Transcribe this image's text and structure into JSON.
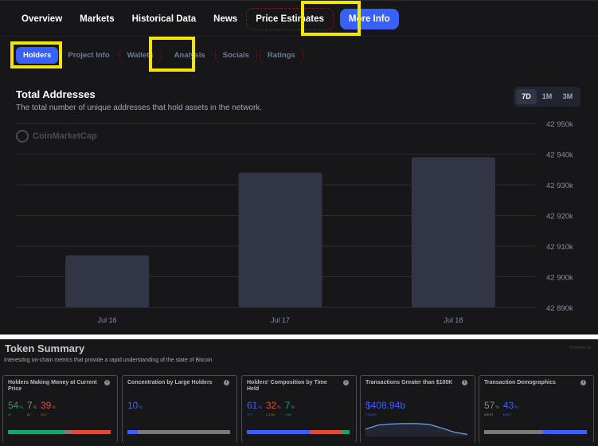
{
  "nav": {
    "items": [
      {
        "label": "Overview"
      },
      {
        "label": "Markets"
      },
      {
        "label": "Historical Data"
      },
      {
        "label": "News"
      },
      {
        "label": "Price Estimates"
      },
      {
        "label": "More Info"
      }
    ],
    "active": "More Info"
  },
  "subnav": {
    "items": [
      {
        "label": "Holders"
      },
      {
        "label": "Project Info"
      },
      {
        "label": "Wallets"
      },
      {
        "label": "Analysis"
      },
      {
        "label": "Socials"
      },
      {
        "label": "Ratings"
      }
    ],
    "active": "Holders"
  },
  "section": {
    "title": "Total Addresses",
    "subtitle": "The total number of unique addresses that hold assets in the network.",
    "watermark": "CoinMarketCap",
    "ranges": [
      "7D",
      "1M",
      "3M"
    ],
    "active_range": "7D"
  },
  "chart_data": {
    "type": "bar",
    "title": "Total Addresses",
    "categories": [
      "Jul 16",
      "Jul 17",
      "Jul 18"
    ],
    "values": [
      42907000,
      42934000,
      42939000
    ],
    "ylim": [
      42890000,
      42950000
    ],
    "yticks": [
      42950000,
      42940000,
      42930000,
      42920000,
      42910000,
      42900000,
      42890000
    ],
    "ytick_labels": [
      "42 950k",
      "42 940k",
      "42 930k",
      "42 920k",
      "42 910k",
      "42 900k",
      "42 890k"
    ],
    "xlabel": "",
    "ylabel": "",
    "grid": true,
    "colors": {
      "bar": "#323546",
      "grid": "#2b2c36",
      "tick": "#858ca2"
    }
  },
  "summary": {
    "title": "Token Summary",
    "subtitle": "Interesting on-chain metrics that provide a rapid understanding of the state of Bitcoin",
    "powered_by": "Powered by",
    "cards": [
      {
        "title": "Holders Making Money at Current Price",
        "values": [
          {
            "num": "54",
            "unit": "%",
            "label": "IN",
            "color": "green"
          },
          {
            "num": "7",
            "unit": "%",
            "label": "AT",
            "color": "gray"
          },
          {
            "num": "39",
            "unit": "%",
            "label": "OUT",
            "color": "red"
          }
        ],
        "bar": [
          54,
          7,
          39
        ]
      },
      {
        "title": "Concentration by Large Holders",
        "values": [
          {
            "num": "10",
            "unit": "%",
            "label": "",
            "color": "blue"
          }
        ],
        "bar": [
          10
        ]
      },
      {
        "title": "Holders' Composition by Time Held",
        "values": [
          {
            "num": "61",
            "unit": "%",
            "label": "1Y+",
            "color": "blue"
          },
          {
            "num": "32",
            "unit": "%",
            "label": "1-12M",
            "color": "red"
          },
          {
            "num": "7",
            "unit": "%",
            "label": "<1M",
            "color": "green"
          }
        ],
        "bar": [
          61,
          32,
          7
        ]
      },
      {
        "title": "Transactions Greater than $100K",
        "value": "$408.94b",
        "value_label": "7 DAYS",
        "spark": [
          0.35,
          0.55,
          0.6,
          0.62,
          0.62,
          0.58,
          0.4,
          0.2,
          0.1
        ]
      },
      {
        "title": "Transaction Demographics",
        "values": [
          {
            "num": "57",
            "unit": "%",
            "label": "WEST",
            "color": "gray"
          },
          {
            "num": "43",
            "unit": "%",
            "label": "EAST",
            "color": "blue"
          }
        ],
        "bar": [
          57,
          43
        ]
      }
    ]
  }
}
